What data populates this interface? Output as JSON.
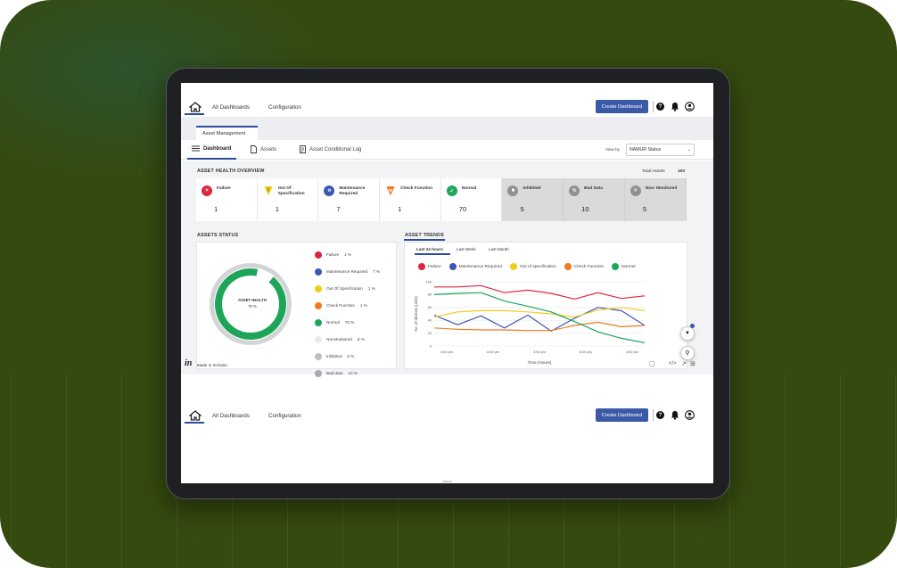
{
  "colors": {
    "background": "#354a0f",
    "accent": "#3a5aa8",
    "failure": "#e0263f",
    "maintenance": "#3c57b5",
    "out_of_spec": "#f2cd1d",
    "check_function": "#ee7a22",
    "normal": "#1fa55a",
    "grey_status": "#a9abad"
  },
  "nav": {
    "home_icon": "home-icon",
    "all_dashboards": "All Dashboards",
    "configuration": "Configuration",
    "create_dashboard": "Create Dashboard",
    "help_icon": "question-circle-icon",
    "bell_icon": "bell-icon",
    "user_icon": "user-circle-icon"
  },
  "tab_asset_management": "Asset Management",
  "subtabs": {
    "dashboard": "Dashboard",
    "assets": "Assets",
    "asset_log": "Asset Conditional Log"
  },
  "view_by": {
    "label": "View by",
    "value": "NAMUR Status"
  },
  "overview": {
    "title": "ASSET HEALTH OVERVIEW",
    "total_label": "Total Assets",
    "total_value": "100",
    "cards": [
      {
        "label": "Failure",
        "count": "1",
        "icon": "failure-icon"
      },
      {
        "label": "Out Of Specification",
        "count": "1",
        "icon": "warning-icon"
      },
      {
        "label": "Maintenance Required",
        "count": "7",
        "icon": "wrench-icon"
      },
      {
        "label": "Check Function",
        "count": "1",
        "icon": "check-function-icon"
      },
      {
        "label": "Normal",
        "count": "70",
        "icon": "normal-check-icon"
      },
      {
        "label": "Inhibited",
        "count": "5",
        "icon": "inhibited-icon"
      },
      {
        "label": "Bad Data",
        "count": "10",
        "icon": "bad-data-icon"
      },
      {
        "label": "Non- Monitored",
        "count": "5",
        "icon": "non-monitored-icon"
      }
    ]
  },
  "assets_status": {
    "title": "ASSETS  STATUS",
    "donut_label": "ASSET HEALTH",
    "donut_value": "70 %",
    "legend": [
      {
        "label": "Failure",
        "pct": "1 %"
      },
      {
        "label": "Maintenance Required",
        "pct": "7 %"
      },
      {
        "label": "Out Of Specification",
        "pct": "1 %"
      },
      {
        "label": "Check Function",
        "pct": "1 %"
      },
      {
        "label": "Normal",
        "pct": "70 %"
      },
      {
        "label": "Not Monitored",
        "pct": "5 %"
      },
      {
        "label": "Inhibited",
        "pct": "5 %"
      },
      {
        "label": "Bad data",
        "pct": "10 %"
      }
    ]
  },
  "asset_trends": {
    "title": "ASSET TRENDS",
    "tabs": [
      "Last 24 hours",
      "Last Week",
      "Last Month"
    ]
  },
  "chart_data": {
    "type": "line",
    "title": "",
    "xlabel": "Time (Hours)",
    "ylabel": "No. of devices (units)",
    "x": [
      0,
      1,
      2,
      3,
      4,
      5,
      6,
      7,
      8,
      9
    ],
    "xticks": [
      "4:00 pm",
      "6:00 pm",
      "4:00 pm",
      "6:00 pm",
      "4:00 pm"
    ],
    "yticks": [
      "0",
      "20",
      "40",
      "60",
      "80",
      "100"
    ],
    "ylim": [
      0,
      100
    ],
    "legend_position": "top",
    "grid": true,
    "series": [
      {
        "name": "Failure",
        "color": "#e0263f",
        "values": [
          92,
          92,
          94,
          83,
          87,
          82,
          73,
          83,
          74,
          78
        ]
      },
      {
        "name": "Maintenance Required",
        "color": "#3c57b5",
        "values": [
          48,
          33,
          47,
          28,
          48,
          23,
          43,
          60,
          55,
          32
        ]
      },
      {
        "name": "Out of specification",
        "color": "#f2cd1d",
        "values": [
          45,
          53,
          55,
          55,
          53,
          50,
          45,
          56,
          60,
          55
        ]
      },
      {
        "name": "Check Function",
        "color": "#ee7a22",
        "values": [
          28,
          26,
          25,
          25,
          24,
          24,
          32,
          37,
          30,
          32
        ]
      },
      {
        "name": "Normal",
        "color": "#1fa55a",
        "values": [
          80,
          82,
          83,
          70,
          62,
          53,
          38,
          22,
          12,
          5
        ]
      }
    ]
  },
  "made_in": "Made in InVision",
  "invision_logo": "invision-logo",
  "bottom_nav": {
    "all_dashboards": "All Dashboards",
    "configuration": "Configuration",
    "create_dashboard": "Create Dashboard"
  }
}
